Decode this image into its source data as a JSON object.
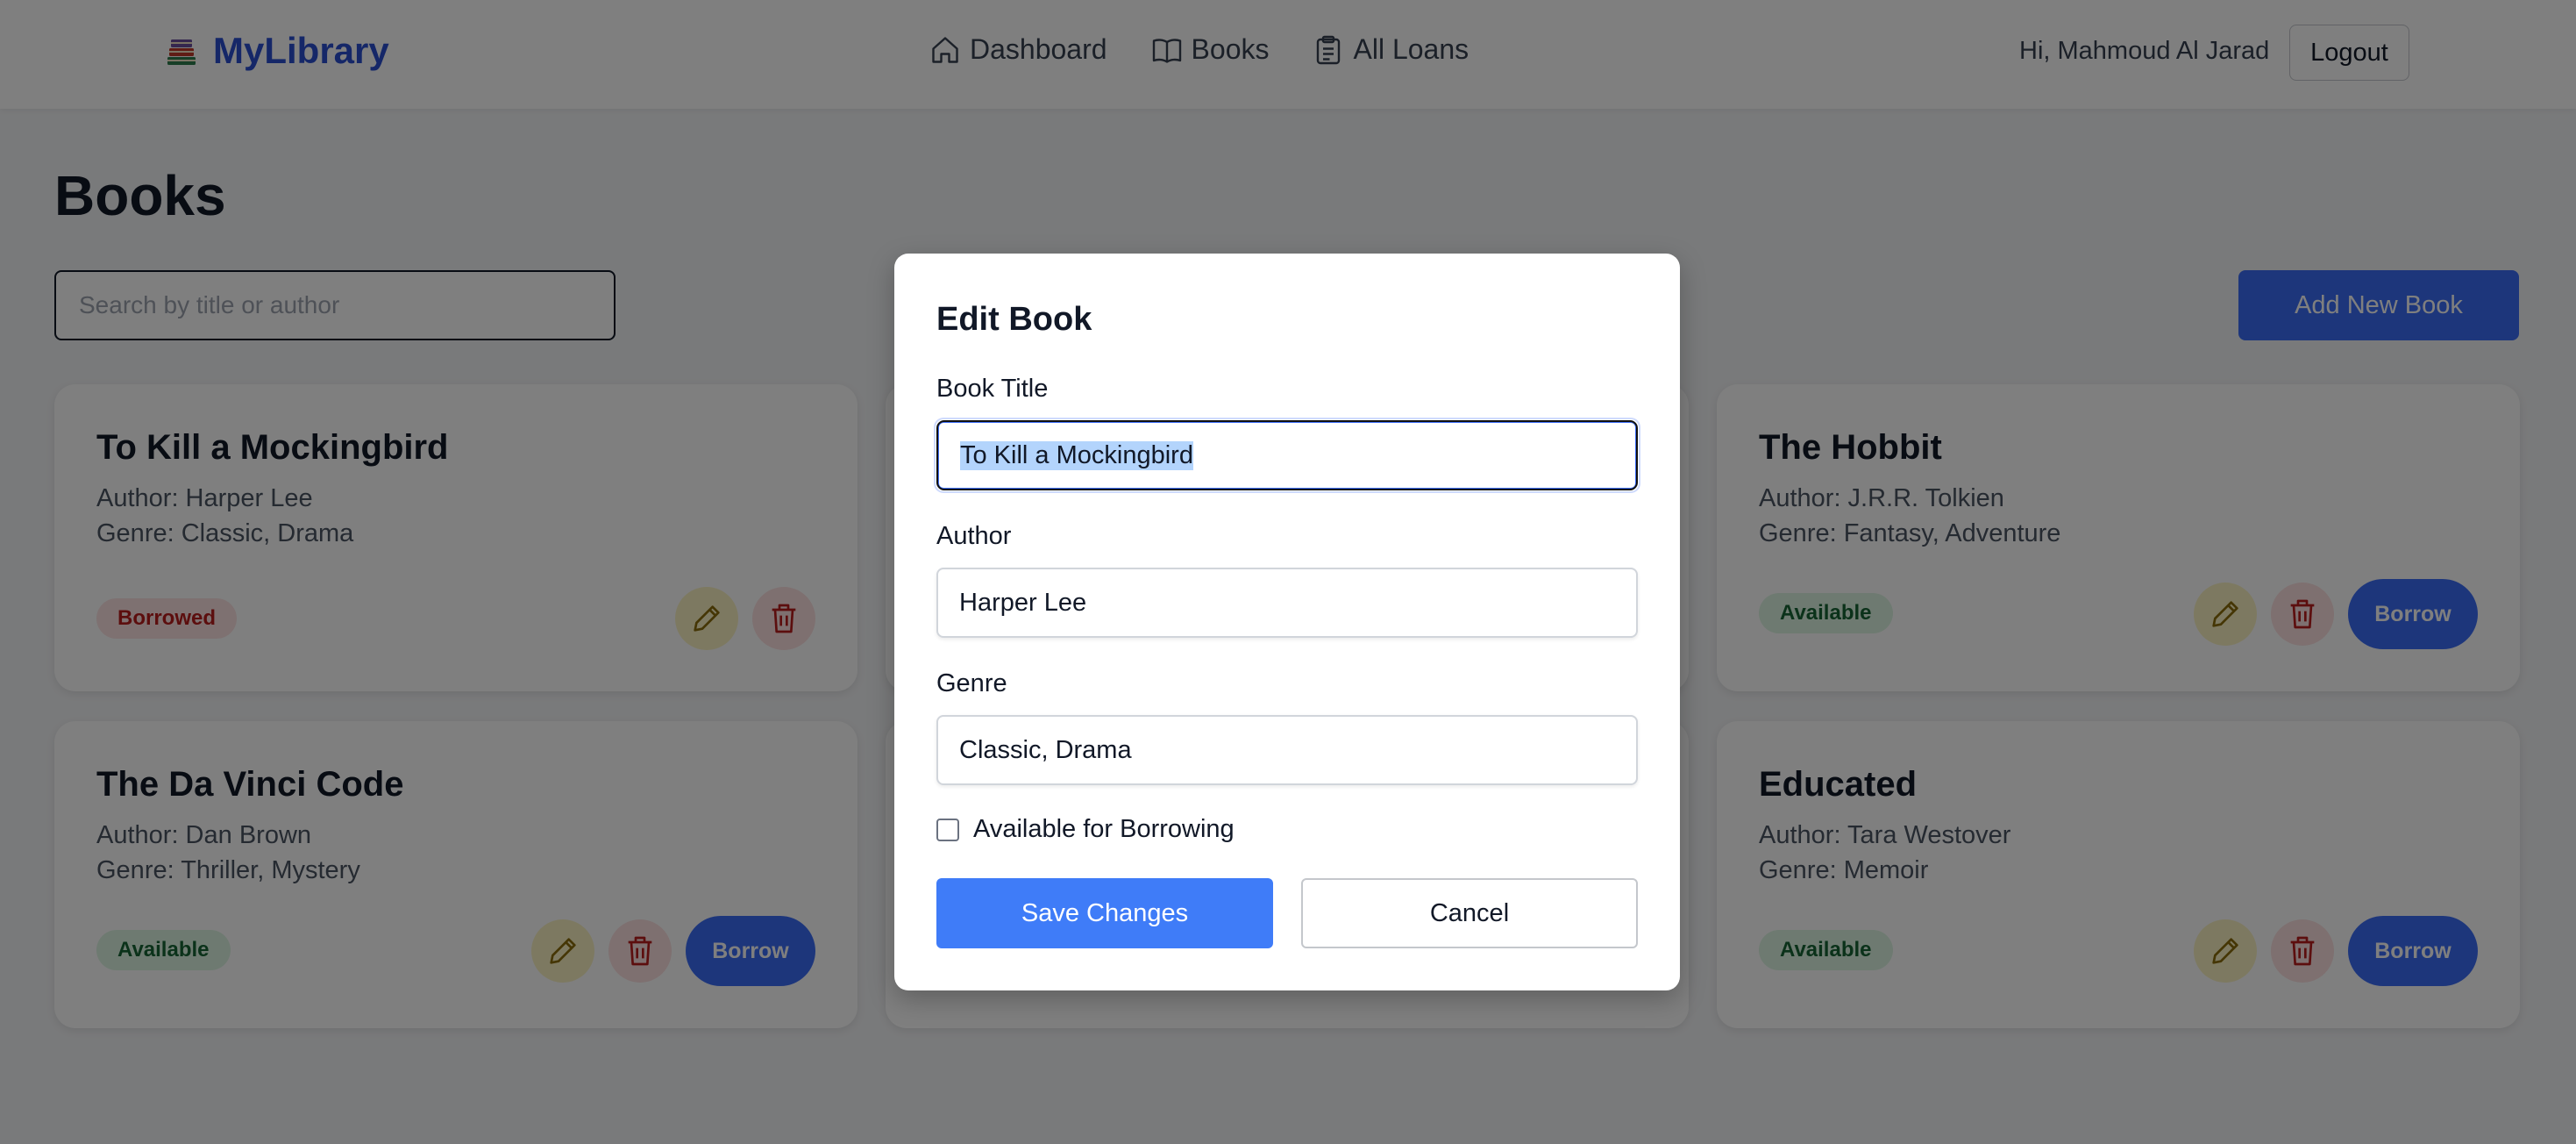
{
  "header": {
    "logo_icon": "books-icon",
    "app_name": "MyLibrary",
    "nav": [
      {
        "label": "Dashboard",
        "icon": "home-icon"
      },
      {
        "label": "Books",
        "icon": "book-open-icon"
      },
      {
        "label": "All Loans",
        "icon": "clipboard-icon"
      }
    ],
    "greeting": "Hi, Mahmoud Al Jarad",
    "logout_label": "Logout"
  },
  "main": {
    "title": "Books",
    "search_placeholder": "Search by title or author",
    "search_value": "",
    "add_button_label": "Add New Book"
  },
  "books": [
    {
      "title": "To Kill a Mockingbird",
      "author": "Author: Harper Lee",
      "genre": "Genre: Classic, Drama",
      "status": "Borrowed",
      "can_borrow": false
    },
    {
      "title": "The Hobbit",
      "author": "Author: J.R.R. Tolkien",
      "genre": "Genre: Fantasy, Adventure",
      "status": "Available",
      "can_borrow": true
    },
    {
      "title": "The Da Vinci Code",
      "author": "Author: Dan Brown",
      "genre": "Genre: Thriller, Mystery",
      "status": "Available",
      "can_borrow": true
    },
    {
      "title": "Educated",
      "author": "Author: Tara Westover",
      "genre": "Genre: Memoir",
      "status": "Available",
      "can_borrow": true
    }
  ],
  "borrow_label": "Borrow",
  "modal": {
    "title": "Edit Book",
    "fields": [
      {
        "label": "Book Title",
        "value": "To Kill a Mockingbird"
      },
      {
        "label": "Author",
        "value": "Harper Lee"
      },
      {
        "label": "Genre",
        "value": "Classic, Drama"
      }
    ],
    "checkbox_label": "Available for Borrowing",
    "checkbox_checked": false,
    "save_label": "Save Changes",
    "cancel_label": "Cancel"
  },
  "colors": {
    "brand": "#2b4fd1",
    "primary_button": "#3b6cf6",
    "available_badge_bg": "#dcf5e3",
    "borrowed_badge_bg": "#fde2e2"
  }
}
